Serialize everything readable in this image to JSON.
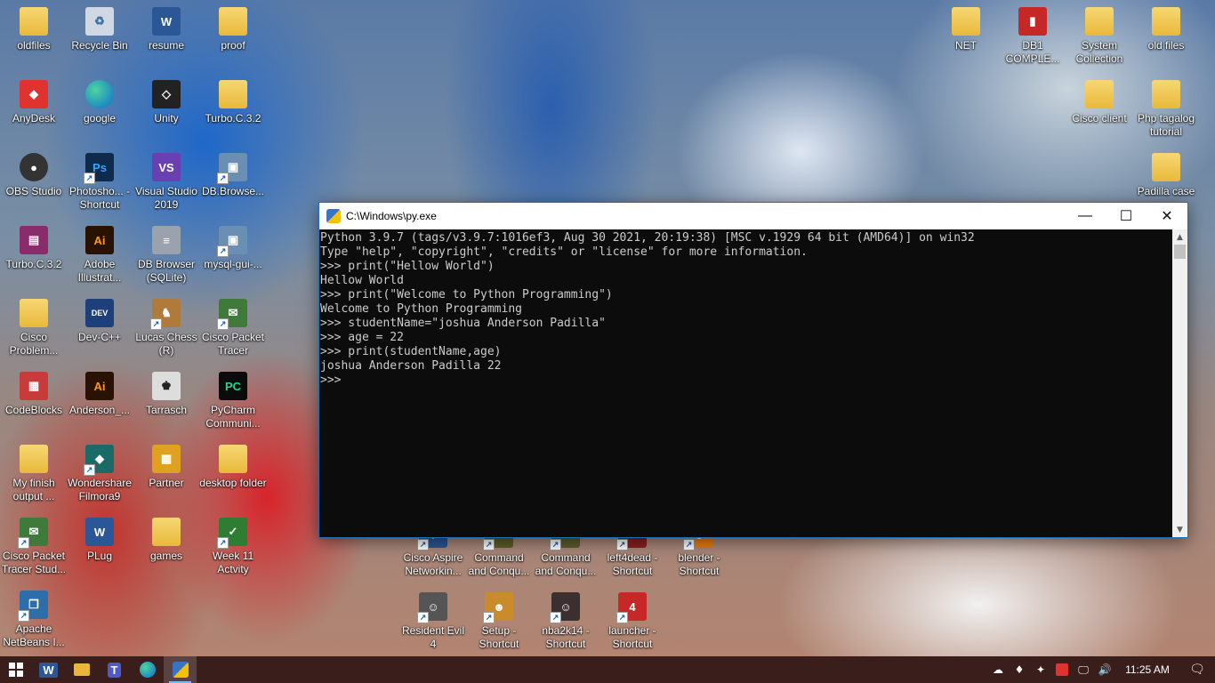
{
  "desktop": {
    "icons_left": [
      {
        "label": "oldfiles",
        "icon": "folder-icon"
      },
      {
        "label": "Recycle Bin",
        "icon": "recycle-bin-icon"
      },
      {
        "label": "resume",
        "icon": "word-doc-icon"
      },
      {
        "label": "proof",
        "icon": "folder-icon"
      },
      {
        "label": "AnyDesk",
        "icon": "anydesk-icon"
      },
      {
        "label": "google",
        "icon": "edge-icon"
      },
      {
        "label": "Unity",
        "icon": "unity-icon"
      },
      {
        "label": "Turbo.C.3.2",
        "icon": "folder-icon"
      },
      {
        "label": "OBS Studio",
        "icon": "obs-icon"
      },
      {
        "label": "Photosho... - Shortcut",
        "icon": "photoshop-icon"
      },
      {
        "label": "Visual Studio 2019",
        "icon": "visual-studio-icon"
      },
      {
        "label": "DB.Browse...",
        "icon": "db-browser-icon"
      },
      {
        "label": "Turbo.C.3.2",
        "icon": "winrar-icon"
      },
      {
        "label": "Adobe Illustrat...",
        "icon": "illustrator-icon"
      },
      {
        "label": "DB Browser (SQLite)",
        "icon": "database-icon"
      },
      {
        "label": "mysql-gui-...",
        "icon": "installer-icon"
      },
      {
        "label": "Cisco Problem...",
        "icon": "folder-icon"
      },
      {
        "label": "Dev-C++",
        "icon": "devcpp-icon"
      },
      {
        "label": "Lucas Chess (R)",
        "icon": "chess-icon"
      },
      {
        "label": "Cisco Packet Tracer",
        "icon": "packet-tracer-icon"
      },
      {
        "label": "CodeBlocks",
        "icon": "codeblocks-icon"
      },
      {
        "label": "Anderson_...",
        "icon": "illustrator-icon"
      },
      {
        "label": "Tarrasch",
        "icon": "chess-board-icon"
      },
      {
        "label": "PyCharm Communi...",
        "icon": "pycharm-icon"
      },
      {
        "label": "My finish output ...",
        "icon": "folder-icon"
      },
      {
        "label": "Wondershare Filmora9",
        "icon": "filmora-icon"
      },
      {
        "label": "Partner",
        "icon": "partner-icon"
      },
      {
        "label": "desktop folder",
        "icon": "folder-icon"
      },
      {
        "label": "Cisco Packet Tracer Stud...",
        "icon": "packet-tracer-icon"
      },
      {
        "label": "PLug",
        "icon": "word-doc-icon"
      },
      {
        "label": "games",
        "icon": "folder-icon"
      },
      {
        "label": "Week 11 Actvity",
        "icon": "camtasia-icon"
      },
      {
        "label": "Apache NetBeans I...",
        "icon": "netbeans-icon"
      }
    ],
    "icons_right": [
      {
        "label": "NET",
        "icon": "folder-icon"
      },
      {
        "label": "DB1 COMPLE...",
        "icon": "pdf-icon"
      },
      {
        "label": "System Collection",
        "icon": "folder-icon"
      },
      {
        "label": "old files",
        "icon": "folder-icon"
      },
      {
        "label": "Cisco client",
        "icon": "folder-icon"
      },
      {
        "label": "Php tagalog tutorial",
        "icon": "folder-icon"
      },
      {
        "label": "Padilla case",
        "icon": "folder-icon"
      }
    ],
    "icons_bottom": [
      {
        "label": "Cisco Aspire Networkin...",
        "icon": "cisco-aspire-icon"
      },
      {
        "label": "Command and Conqu...",
        "icon": "command-conquer-icon"
      },
      {
        "label": "Command and Conqu...",
        "icon": "command-conquer-icon"
      },
      {
        "label": "left4dead - Shortcut",
        "icon": "left4dead-icon"
      },
      {
        "label": "blender - Shortcut",
        "icon": "blender-icon"
      },
      {
        "label": "Resident Evil 4",
        "icon": "resident-evil-icon"
      },
      {
        "label": "Setup - Shortcut",
        "icon": "setup-icon"
      },
      {
        "label": "nba2k14 - Shortcut",
        "icon": "nba2k14-icon"
      },
      {
        "label": "launcher - Shortcut",
        "icon": "launcher-icon"
      }
    ]
  },
  "console_window": {
    "title": "C:\\Windows\\py.exe",
    "lines": [
      "Python 3.9.7 (tags/v3.9.7:1016ef3, Aug 30 2021, 20:19:38) [MSC v.1929 64 bit (AMD64)] on win32",
      "Type \"help\", \"copyright\", \"credits\" or \"license\" for more information.",
      ">>> print(\"Hellow World\")",
      "Hellow World",
      ">>> print(\"Welcome to Python Programming\")",
      "Welcome to Python Programming",
      ">>> studentName=\"joshua Anderson Padilla\"",
      ">>> age = 22",
      ">>> print(studentName,age)",
      "joshua Anderson Padilla 22",
      ">>> "
    ]
  },
  "taskbar": {
    "start_icon": "windows-start-icon",
    "apps": [
      {
        "name": "word",
        "icon": "word-icon"
      },
      {
        "name": "file-explorer",
        "icon": "file-explorer-icon"
      },
      {
        "name": "teams",
        "icon": "teams-icon"
      },
      {
        "name": "edge",
        "icon": "edge-icon"
      },
      {
        "name": "python",
        "icon": "python-icon"
      }
    ],
    "clock": "11:25 AM"
  }
}
